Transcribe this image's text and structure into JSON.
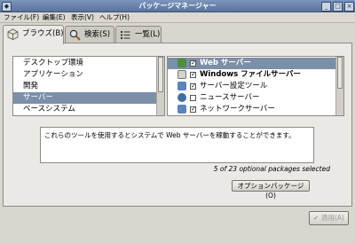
{
  "window": {
    "title": "パッケージマネージャー",
    "controls": [
      "_",
      "□",
      "×"
    ]
  },
  "menu": [
    "ファイル(F)",
    "編集(E)",
    "表示(V)",
    "ヘルプ(H)"
  ],
  "tabs": [
    {
      "label": "ブラウズ(B)",
      "icon": "package-icon",
      "active": true
    },
    {
      "label": "検索(S)",
      "icon": "magnifier-icon",
      "active": false
    },
    {
      "label": "一覧(L)",
      "icon": "list-icon",
      "active": false
    }
  ],
  "categories": [
    {
      "label": "デスクトップ環境",
      "selected": false
    },
    {
      "label": "アプリケーション",
      "selected": false
    },
    {
      "label": "開発",
      "selected": false
    },
    {
      "label": "サーバー",
      "selected": true
    },
    {
      "label": "ベースシステム",
      "selected": false
    }
  ],
  "groups": [
    {
      "label": "Web サーバー",
      "checked": true,
      "selected": true,
      "bold": true,
      "icon": "globe-icon",
      "icon_color": "#4d8f3e"
    },
    {
      "label": "Windows ファイルサーバー",
      "checked": true,
      "selected": false,
      "bold": true,
      "icon": "file-server-icon",
      "icon_color": "#d7d3ca"
    },
    {
      "label": "サーバー設定ツール",
      "checked": true,
      "selected": false,
      "bold": false,
      "icon": "settings-tool-icon",
      "icon_color": "#5c82b6"
    },
    {
      "label": "ニュースサーバー",
      "checked": false,
      "selected": false,
      "bold": false,
      "icon": "news-icon",
      "icon_color": "#3f6fa0"
    },
    {
      "label": "ネットワークサーバー",
      "checked": true,
      "selected": false,
      "bold": false,
      "icon": "network-icon",
      "icon_color": "#5c82b6"
    }
  ],
  "description": "これらのツールを使用するとシステムで Web サーバーを稼動することができます。",
  "count_text": "5 of 23 optional packages selected",
  "optional_button": "オプションパッケージ(O)",
  "apply_button": "適用(A)",
  "colors": {
    "selection": "#7c8fa8",
    "titlebar": "#6a86af",
    "window_bg": "#d9d6cf"
  }
}
